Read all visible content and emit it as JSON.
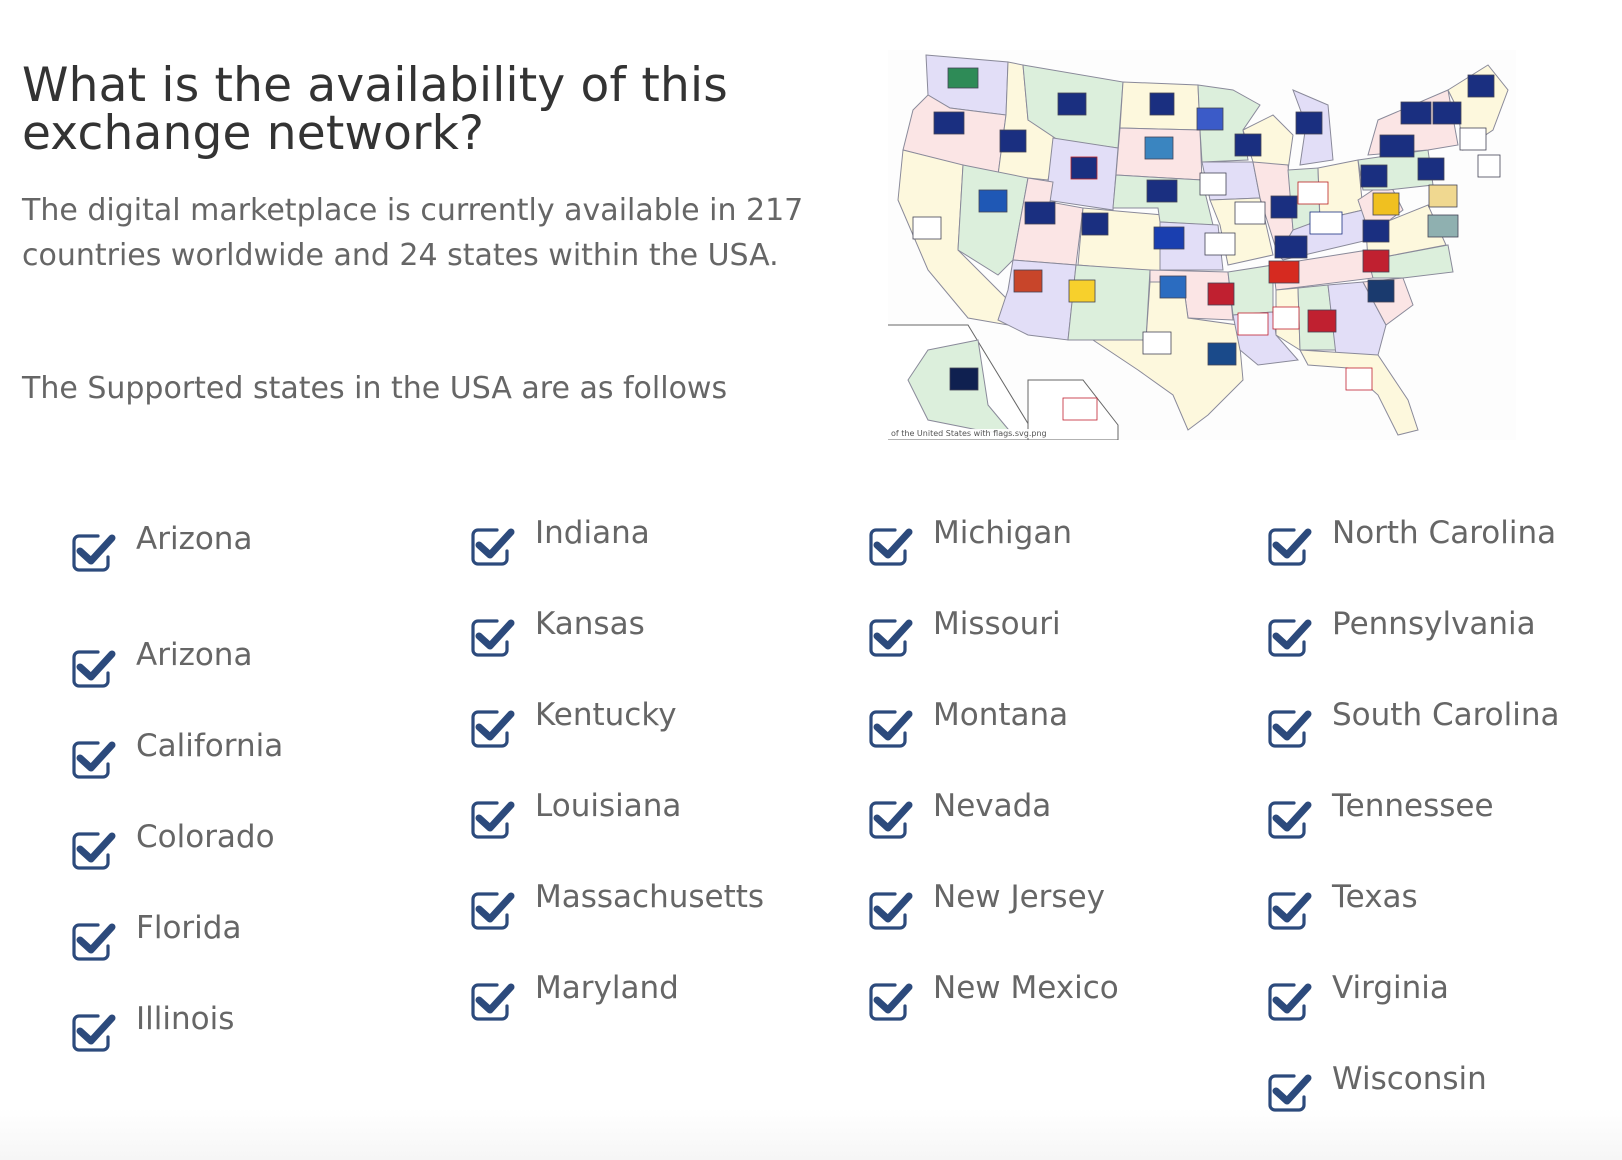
{
  "header": {
    "title": "What is the availability of this exchange network?"
  },
  "intro": {
    "text": "The digital marketplace is currently available in 217 countries worldwide and 24 states within the USA.",
    "supported_label": "The Supported states in the USA are as follows"
  },
  "map": {
    "image_alt": "Map of the United States with state flags",
    "caption": "of the United States with flags.svg.png"
  },
  "colors": {
    "heading": "#333333",
    "body_text": "#666666",
    "check_icon": "#2c4a7c"
  },
  "states": {
    "columns": [
      [
        "Arizona",
        "Arizona",
        "California",
        "Colorado",
        "Florida",
        "Illinois"
      ],
      [
        "Indiana",
        "Kansas",
        "Kentucky",
        "Louisiana",
        "Massachusetts",
        "Maryland"
      ],
      [
        "Michigan",
        "Missouri",
        "Montana",
        "Nevada",
        "New Jersey",
        "New Mexico"
      ],
      [
        "North Carolina",
        "Pennsylvania",
        "South Carolina",
        "Tennessee",
        "Texas",
        "Virginia",
        "Wisconsin"
      ]
    ],
    "icon": "checkbox-checked-icon"
  }
}
